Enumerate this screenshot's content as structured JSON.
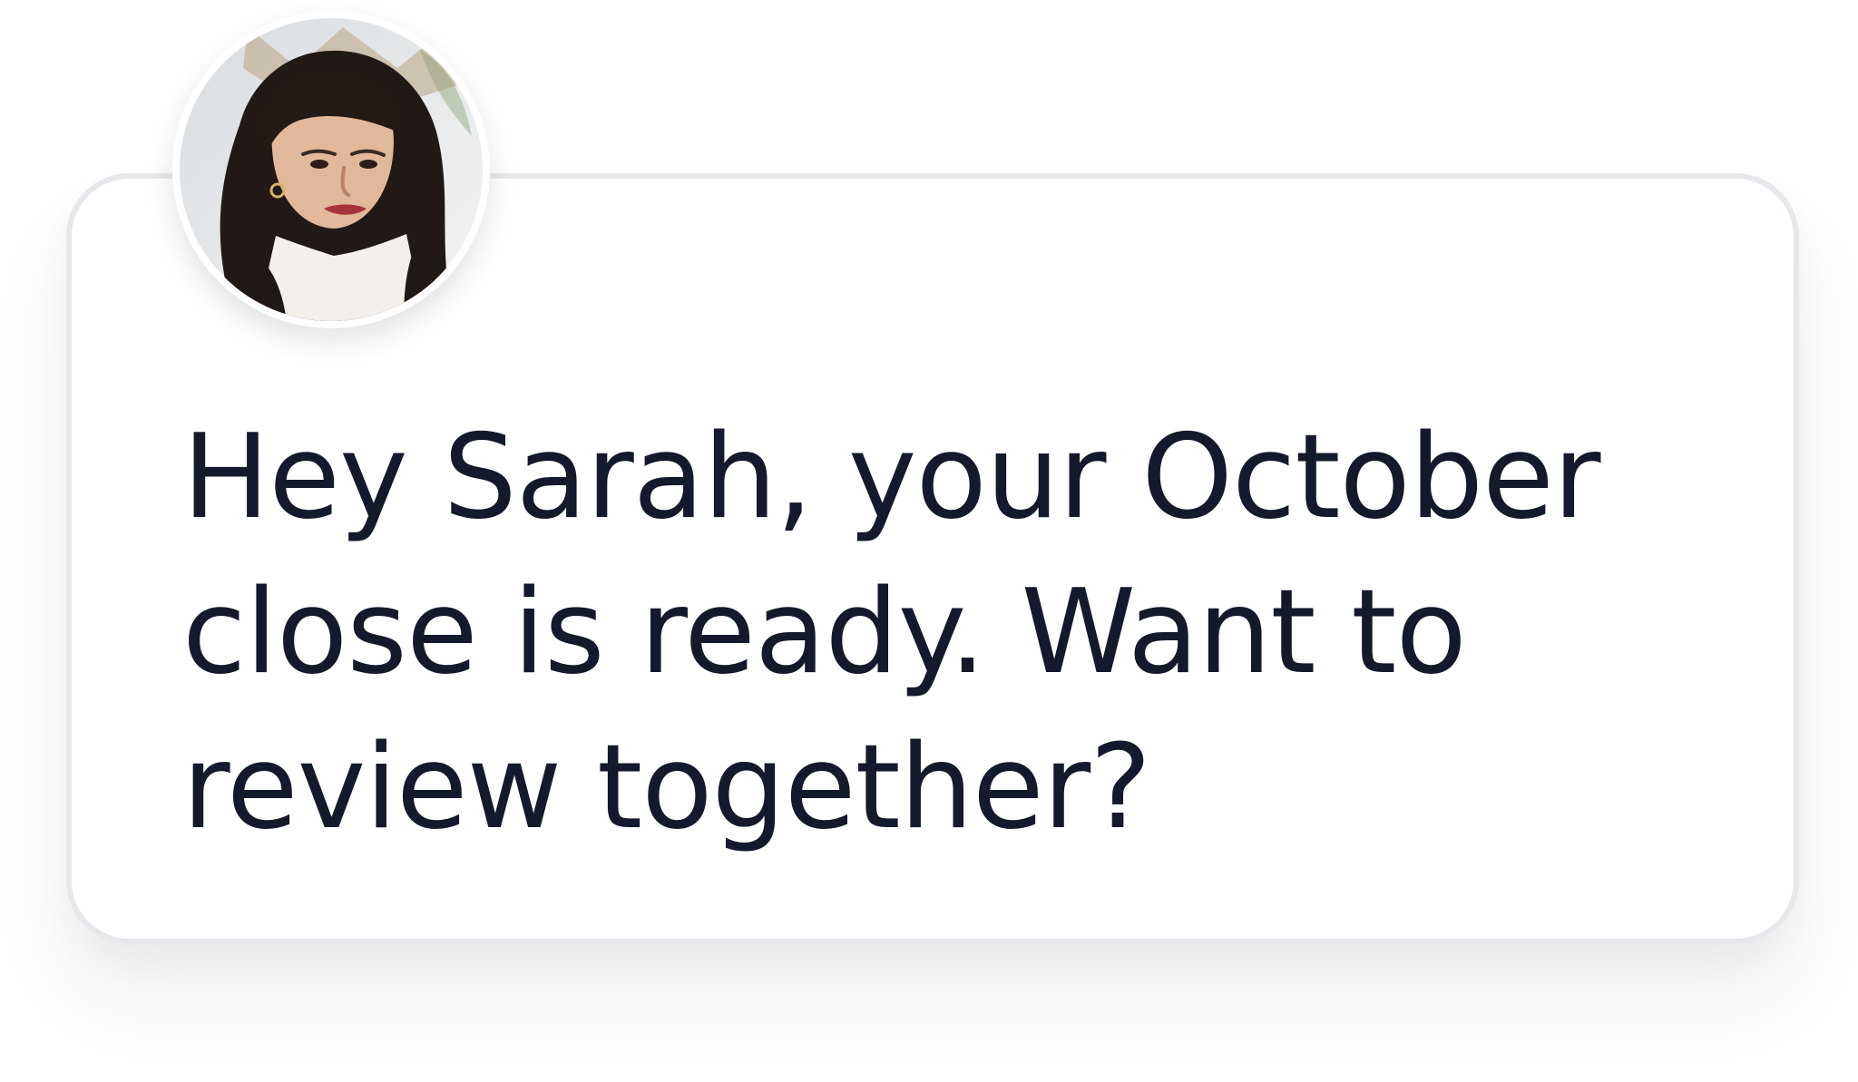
{
  "message": {
    "text": "Hey Sarah, your October close is ready. Want to review together?"
  },
  "avatar": {
    "icon": "person-photo-avatar"
  },
  "colors": {
    "text": "#141a2b",
    "card_border": "#e7e8ec",
    "background": "#ffffff"
  }
}
